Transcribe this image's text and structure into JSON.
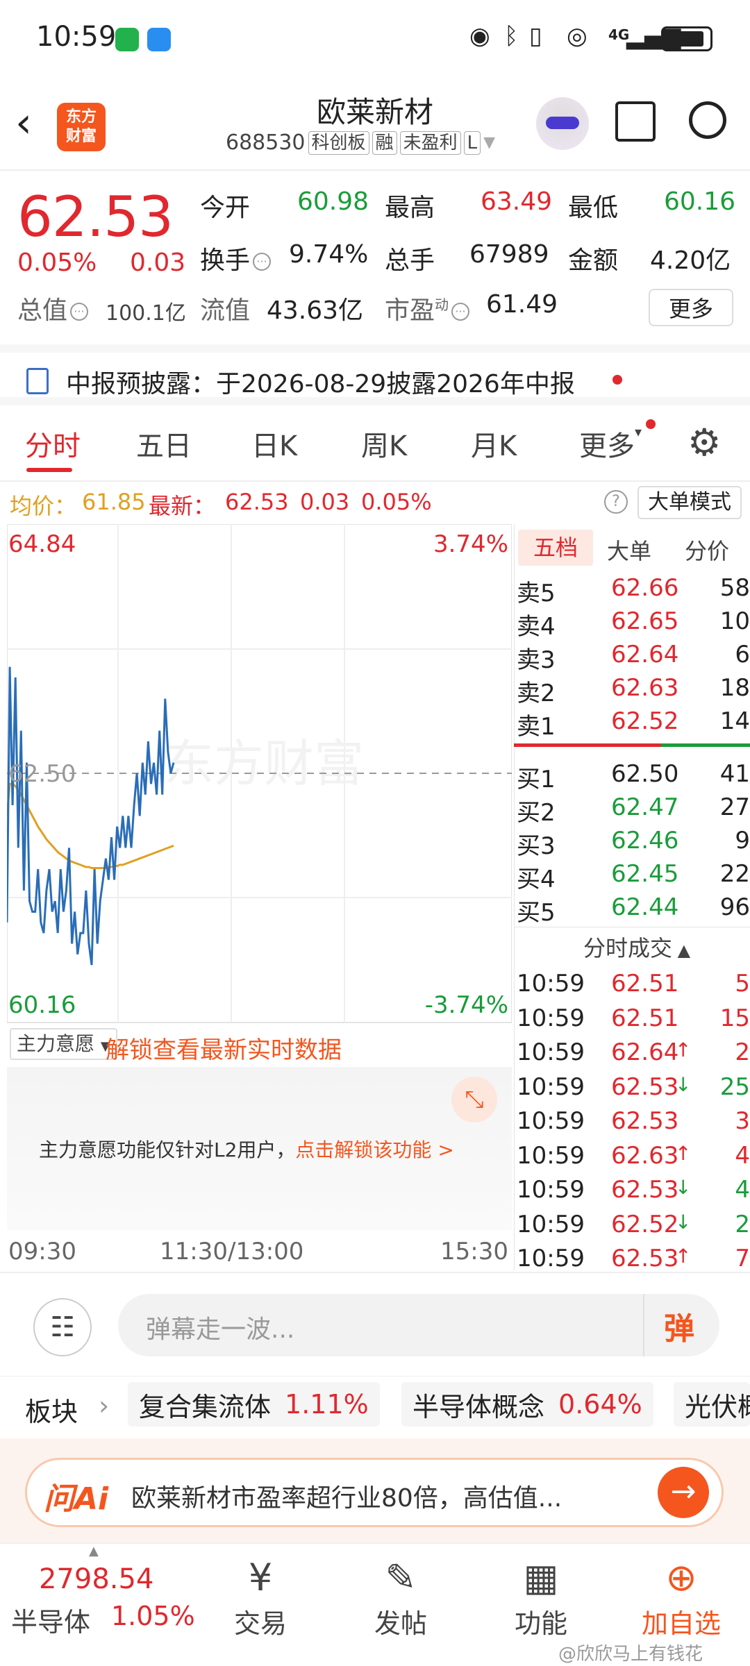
{
  "status": {
    "time": "10:59",
    "signal": "4G"
  },
  "header": {
    "logo_line1": "东方",
    "logo_line2": "财富",
    "title": "欧莱新材",
    "code": "688530",
    "tags": [
      "科创板",
      "融",
      "未盈利",
      "L"
    ]
  },
  "quote": {
    "price": "62.53",
    "change_pct": "0.05%",
    "change": "0.03",
    "open_label": "今开",
    "open": "60.98",
    "high_label": "最高",
    "high": "63.49",
    "low_label": "最低",
    "low": "60.16",
    "turnover_label": "换手",
    "turnover": "9.74%",
    "volume_label": "总手",
    "volume": "67989",
    "amount_label": "金额",
    "amount": "4.20亿",
    "mktcap_label": "总值",
    "mktcap": "100.1亿",
    "float_label": "流值",
    "float": "43.63亿",
    "pe_label": "市盈",
    "pe_sup": "动",
    "pe": "61.49",
    "more": "更多"
  },
  "notice": {
    "text": "中报预披露：于2026-08-29披露2026年中报"
  },
  "tabs": [
    "分时",
    "五日",
    "日K",
    "周K",
    "月K",
    "更多"
  ],
  "avg": {
    "avg_label": "均价：",
    "avg": "61.85",
    "latest_label": "最新：",
    "latest": "62.53",
    "change": "0.03",
    "change_pct": "0.05%",
    "mode_button": "大单模式"
  },
  "chart_data": {
    "type": "line",
    "y_max_label": "64.84",
    "y_min_label": "60.16",
    "pct_max_label": "3.74%",
    "pct_min_label": "-3.74%",
    "ref_label": "62.50",
    "watermark": "东方财富",
    "ylim": [
      60.16,
      64.84
    ],
    "ref": 62.5,
    "x_labels": [
      "09:30",
      "11:30/13:00",
      "15:30"
    ],
    "series": [
      {
        "values": [
          61.1,
          63.5,
          62.2,
          63.4,
          61.8,
          62.9,
          61.4,
          62.6,
          61.3,
          61.2,
          61.2,
          61.6,
          61.1,
          61.0,
          61.4,
          61.6,
          61.2,
          61.3,
          61.0,
          61.6,
          61.2,
          61.4,
          61.8,
          60.9,
          61.2,
          60.8,
          61.0,
          61.0,
          61.4,
          60.9,
          60.7,
          61.6,
          60.9,
          61.3,
          61.5,
          61.7,
          61.5,
          61.9,
          61.5,
          62.0,
          61.8,
          62.1,
          61.8,
          62.1,
          61.8,
          62.2,
          62.5,
          62.1,
          62.6,
          62.3,
          62.8,
          62.4,
          62.6,
          62.3,
          62.9,
          62.3,
          63.2,
          62.7,
          62.5,
          62.6
        ]
      },
      {
        "values": [
          62.1,
          62.4,
          62.4,
          62.38,
          62.34,
          62.3,
          62.25,
          62.2,
          62.15,
          62.1,
          62.05,
          62.0,
          61.96,
          61.92,
          61.88,
          61.85,
          61.82,
          61.79,
          61.76,
          61.74,
          61.72,
          61.7,
          61.68,
          61.67,
          61.66,
          61.65,
          61.64,
          61.63,
          61.62,
          61.62,
          61.61,
          61.61,
          61.61,
          61.61,
          61.61,
          61.61,
          61.62,
          61.62,
          61.63,
          61.63,
          61.64,
          61.64,
          61.65,
          61.66,
          61.67,
          61.68,
          61.69,
          61.7,
          61.71,
          61.72,
          61.73,
          61.74,
          61.75,
          61.76,
          61.77,
          61.78,
          61.79,
          61.8,
          61.81,
          61.82
        ]
      }
    ]
  },
  "book": {
    "tabs": [
      "五档",
      "大单",
      "分价"
    ],
    "asks": [
      {
        "label": "卖5",
        "price": "62.66",
        "vol": "58"
      },
      {
        "label": "卖4",
        "price": "62.65",
        "vol": "10"
      },
      {
        "label": "卖3",
        "price": "62.64",
        "vol": "6"
      },
      {
        "label": "卖2",
        "price": "62.63",
        "vol": "18"
      },
      {
        "label": "卖1",
        "price": "62.52",
        "vol": "14"
      }
    ],
    "bids": [
      {
        "label": "买1",
        "price": "62.50",
        "vol": "41"
      },
      {
        "label": "买2",
        "price": "62.47",
        "vol": "27"
      },
      {
        "label": "买3",
        "price": "62.46",
        "vol": "9"
      },
      {
        "label": "买4",
        "price": "62.45",
        "vol": "22"
      },
      {
        "label": "买5",
        "price": "62.44",
        "vol": "96"
      }
    ],
    "trades_title": "分时成交",
    "trades": [
      {
        "time": "10:59",
        "price": "62.51",
        "arrow": "",
        "vol": "5"
      },
      {
        "time": "10:59",
        "price": "62.51",
        "arrow": "",
        "vol": "15"
      },
      {
        "time": "10:59",
        "price": "62.64",
        "arrow": "↑",
        "vol": "2"
      },
      {
        "time": "10:59",
        "price": "62.53",
        "arrow": "↓",
        "vol": "25"
      },
      {
        "time": "10:59",
        "price": "62.53",
        "arrow": "",
        "vol": "3"
      },
      {
        "time": "10:59",
        "price": "62.63",
        "arrow": "↑",
        "vol": "4"
      },
      {
        "time": "10:59",
        "price": "62.53",
        "arrow": "↓",
        "vol": "4"
      },
      {
        "time": "10:59",
        "price": "62.52",
        "arrow": "↓",
        "vol": "2"
      },
      {
        "time": "10:59",
        "price": "62.53",
        "arrow": "↑",
        "vol": "7"
      }
    ]
  },
  "zhuli": {
    "select": "主力意愿",
    "unlock": "解锁查看最新实时数据",
    "msg": "主力意愿功能仅针对L2用户，",
    "link": "点击解锁该功能 >"
  },
  "danmu": {
    "placeholder": "弹幕走一波...",
    "button": "弹"
  },
  "sector": {
    "label": "板块",
    "chips": [
      {
        "name": "复合集流体",
        "pct": "1.11%"
      },
      {
        "name": "半导体概念",
        "pct": "0.64%"
      },
      {
        "name": "光伏概",
        "pct": ""
      }
    ]
  },
  "ai": {
    "brand": "问Ai",
    "text": "欧莱新材市盈率超行业80倍，高估值..."
  },
  "nav": {
    "index_value": "2798.54",
    "index_name": "半导体",
    "index_pct": "1.05%",
    "items": [
      "交易",
      "发帖",
      "功能",
      "加自选"
    ],
    "watermark": "@欣欣马上有钱花"
  },
  "colors": {
    "up": "#e0282e",
    "down": "#1a9c3a",
    "accent": "#f4561e",
    "price_line": "#2a6db8",
    "avg_line": "#e0a020"
  }
}
